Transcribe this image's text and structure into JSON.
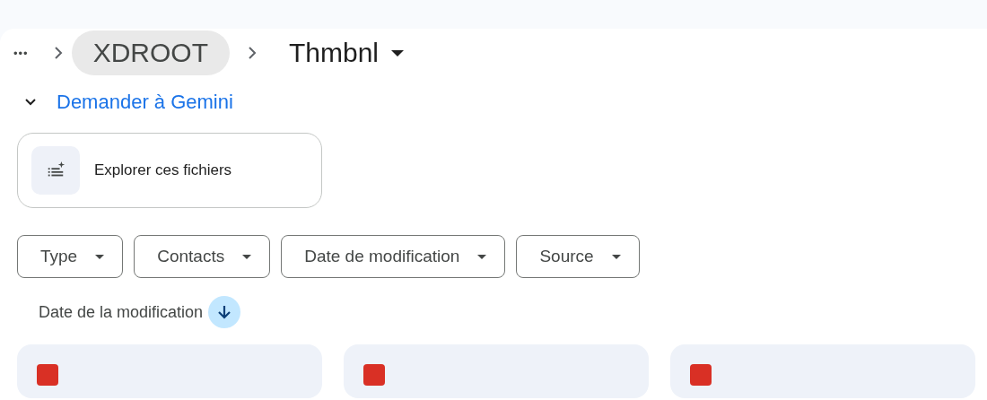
{
  "breadcrumb": {
    "overflow": "•••",
    "items": [
      {
        "label": "XDROOT",
        "selected": false
      },
      {
        "label": "Thmbnl",
        "selected": true
      }
    ]
  },
  "gemini": {
    "title": "Demander à Gemini",
    "expanded": true,
    "action": "Explorer ces fichiers"
  },
  "filters": [
    {
      "label": "Type"
    },
    {
      "label": "Contacts"
    },
    {
      "label": "Date de modification"
    },
    {
      "label": "Source"
    }
  ],
  "sort": {
    "label": "Date de la modification"
  },
  "cards": [
    {
      "kind": "file"
    },
    {
      "kind": "file"
    },
    {
      "kind": "file"
    }
  ]
}
